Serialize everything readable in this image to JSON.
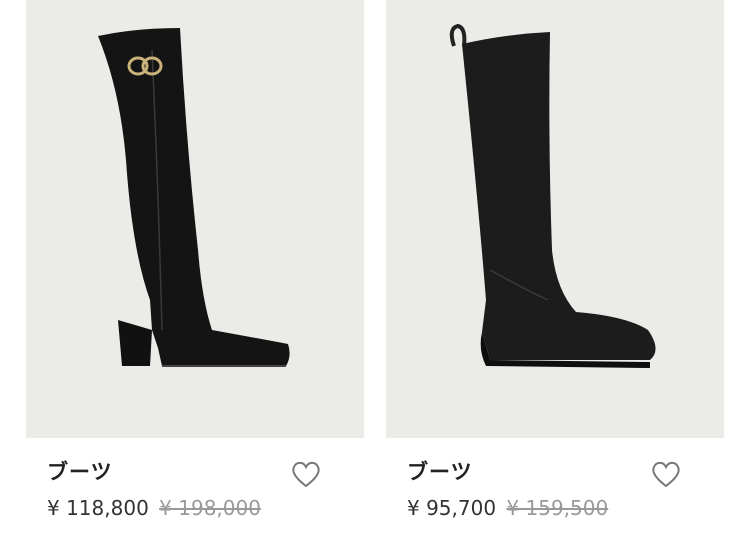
{
  "products": [
    {
      "image_alt": "black heeled knee-high boot with gold buckle",
      "name": "ブーツ",
      "price": "¥ 118,800",
      "original_price": "¥ 198,000",
      "favorite_icon": "heart-outline-icon"
    },
    {
      "image_alt": "black wedge knee-high boot with pull tab",
      "name": "ブーツ",
      "price": "¥ 95,700",
      "original_price": "¥ 159,500",
      "favorite_icon": "heart-outline-icon"
    }
  ],
  "colors": {
    "photo_bg": "#ebebe8",
    "boot": "#1a1a1a",
    "text": "#222222",
    "strike": "#999999"
  }
}
